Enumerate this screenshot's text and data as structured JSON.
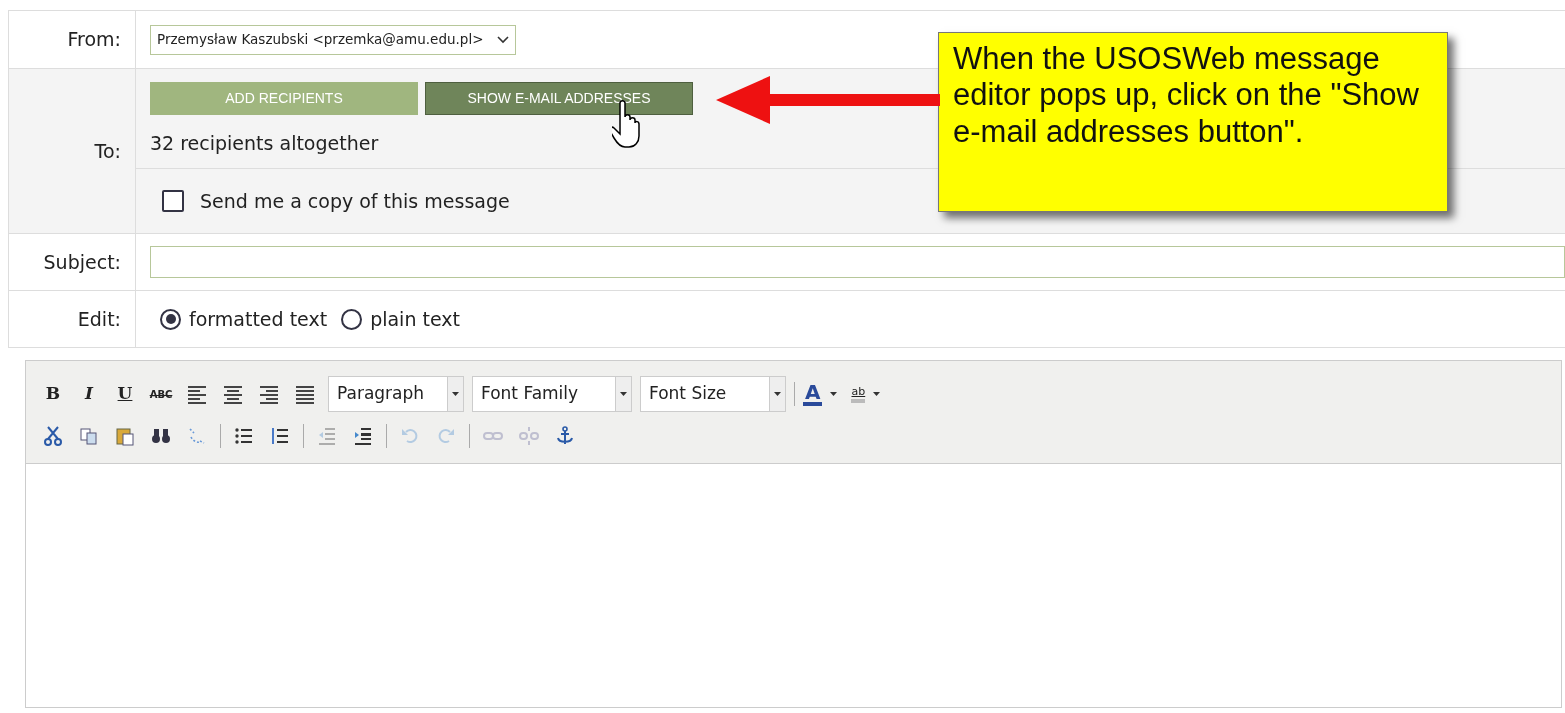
{
  "from": {
    "label": "From:",
    "value": "Przemysław Kaszubski <przemka@amu.edu.pl>"
  },
  "to": {
    "label": "To:",
    "buttons": [
      {
        "label": "ADD RECIPIENTS",
        "kind": "light"
      },
      {
        "label": "SHOW E-MAIL ADDRESSES",
        "kind": "dark"
      }
    ],
    "count": "32 recipients altogether",
    "copy_option": {
      "label": "Send me a copy of this message",
      "checked": false
    }
  },
  "subject": {
    "label": "Subject:"
  },
  "edit": {
    "label": "Edit:",
    "options": [
      {
        "label": "formatted text",
        "selected": true
      },
      {
        "label": "plain text",
        "selected": false
      }
    ]
  },
  "toolbar": {
    "format_buttons": [
      "B",
      "I",
      "U",
      "ABC"
    ],
    "dropdowns": [
      "Paragraph",
      "Font Family",
      "Font Size"
    ],
    "text_color": "A",
    "highlight": "ab",
    "row_2": [
      {
        "disabled": false
      },
      {
        "disabled": false
      },
      {
        "disabled": false
      },
      {
        "disabled": false
      },
      {
        "disabled": false
      },
      {
        "disabled": false
      },
      {
        "disabled": false
      },
      {
        "disabled": true
      },
      {
        "disabled": false
      },
      {
        "disabled": true
      },
      {
        "disabled": true
      },
      {
        "disabled": true
      },
      {
        "disabled": true
      },
      {
        "disabled": false
      }
    ]
  },
  "callout": {
    "text": "When the USOSWeb message editor pops up, click on the \"Show e-mail addresses button\"."
  }
}
